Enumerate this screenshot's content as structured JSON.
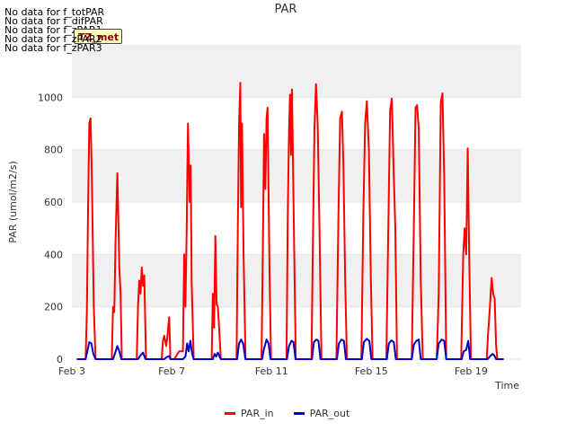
{
  "no_data_messages": [
    "No data for f_totPAR",
    "No data for f_difPAR",
    "No data for f_zPAR1",
    "No data for f_zPAR2",
    "No data for f_zPAR3"
  ],
  "badge_text": "TZ_met",
  "colors": {
    "PAR_in": "#ff0000",
    "PAR_out": "#0000cc",
    "band": "#f0f0f0",
    "grid": "#ffffff"
  },
  "chart_data": {
    "type": "line",
    "title": "PAR",
    "xlabel": "Time",
    "ylabel": "PAR (umol/m2/s)",
    "xlim": [
      3.0,
      21.0
    ],
    "ylim": [
      0,
      1200
    ],
    "yticks": [
      0,
      200,
      400,
      600,
      800,
      1000
    ],
    "xticks": [
      3,
      7,
      11,
      15,
      19
    ],
    "xtick_labels": [
      "Feb 3",
      "Feb 7",
      "Feb 11",
      "Feb 15",
      "Feb 19"
    ],
    "legend": "bottom-center",
    "grid": true,
    "series": [
      {
        "name": "PAR_in",
        "points": [
          [
            3.2,
            0
          ],
          [
            3.55,
            0
          ],
          [
            3.6,
            180
          ],
          [
            3.65,
            600
          ],
          [
            3.7,
            900
          ],
          [
            3.75,
            920
          ],
          [
            3.8,
            700
          ],
          [
            3.88,
            200
          ],
          [
            3.95,
            0
          ],
          [
            4.6,
            0
          ],
          [
            4.65,
            200
          ],
          [
            4.7,
            180
          ],
          [
            4.75,
            450
          ],
          [
            4.82,
            710
          ],
          [
            4.86,
            540
          ],
          [
            4.9,
            350
          ],
          [
            4.95,
            250
          ],
          [
            5.0,
            0
          ],
          [
            5.6,
            0
          ],
          [
            5.65,
            200
          ],
          [
            5.7,
            300
          ],
          [
            5.75,
            250
          ],
          [
            5.8,
            350
          ],
          [
            5.85,
            280
          ],
          [
            5.9,
            320
          ],
          [
            5.97,
            0
          ],
          [
            6.6,
            0
          ],
          [
            6.65,
            70
          ],
          [
            6.7,
            90
          ],
          [
            6.78,
            50
          ],
          [
            6.82,
            80
          ],
          [
            6.9,
            160
          ],
          [
            6.95,
            0
          ],
          [
            7.1,
            0
          ],
          [
            7.3,
            30
          ],
          [
            7.45,
            30
          ],
          [
            7.5,
            400
          ],
          [
            7.55,
            200
          ],
          [
            7.6,
            500
          ],
          [
            7.65,
            900
          ],
          [
            7.72,
            600
          ],
          [
            7.76,
            740
          ],
          [
            7.8,
            300
          ],
          [
            7.88,
            0
          ],
          [
            8.6,
            0
          ],
          [
            8.65,
            250
          ],
          [
            8.7,
            120
          ],
          [
            8.75,
            470
          ],
          [
            8.8,
            210
          ],
          [
            8.85,
            200
          ],
          [
            8.9,
            120
          ],
          [
            8.97,
            0
          ],
          [
            9.6,
            0
          ],
          [
            9.65,
            500
          ],
          [
            9.7,
            900
          ],
          [
            9.75,
            1055
          ],
          [
            9.78,
            580
          ],
          [
            9.82,
            900
          ],
          [
            9.88,
            400
          ],
          [
            9.96,
            0
          ],
          [
            10.6,
            0
          ],
          [
            10.65,
            400
          ],
          [
            10.7,
            860
          ],
          [
            10.75,
            650
          ],
          [
            10.8,
            920
          ],
          [
            10.84,
            960
          ],
          [
            10.88,
            650
          ],
          [
            10.92,
            330
          ],
          [
            10.98,
            0
          ],
          [
            11.6,
            0
          ],
          [
            11.65,
            550
          ],
          [
            11.7,
            870
          ],
          [
            11.74,
            1010
          ],
          [
            11.78,
            780
          ],
          [
            11.82,
            1030
          ],
          [
            11.88,
            600
          ],
          [
            11.97,
            0
          ],
          [
            12.6,
            0
          ],
          [
            12.65,
            400
          ],
          [
            12.72,
            880
          ],
          [
            12.78,
            1050
          ],
          [
            12.85,
            900
          ],
          [
            12.92,
            500
          ],
          [
            13.0,
            0
          ],
          [
            13.6,
            0
          ],
          [
            13.68,
            550
          ],
          [
            13.75,
            920
          ],
          [
            13.82,
            945
          ],
          [
            13.88,
            750
          ],
          [
            13.95,
            300
          ],
          [
            14.02,
            0
          ],
          [
            14.6,
            0
          ],
          [
            14.68,
            550
          ],
          [
            14.75,
            900
          ],
          [
            14.82,
            985
          ],
          [
            14.9,
            800
          ],
          [
            14.98,
            300
          ],
          [
            15.05,
            0
          ],
          [
            15.6,
            0
          ],
          [
            15.68,
            500
          ],
          [
            15.75,
            950
          ],
          [
            15.82,
            995
          ],
          [
            15.9,
            700
          ],
          [
            15.96,
            500
          ],
          [
            16.03,
            0
          ],
          [
            16.62,
            0
          ],
          [
            16.7,
            500
          ],
          [
            16.77,
            960
          ],
          [
            16.83,
            970
          ],
          [
            16.9,
            880
          ],
          [
            16.98,
            300
          ],
          [
            17.06,
            0
          ],
          [
            17.62,
            0
          ],
          [
            17.7,
            250
          ],
          [
            17.78,
            980
          ],
          [
            17.85,
            1015
          ],
          [
            17.92,
            700
          ],
          [
            18.0,
            0
          ],
          [
            18.6,
            0
          ],
          [
            18.68,
            400
          ],
          [
            18.74,
            500
          ],
          [
            18.8,
            400
          ],
          [
            18.86,
            805
          ],
          [
            18.92,
            400
          ],
          [
            18.99,
            0
          ],
          [
            19.62,
            0
          ],
          [
            19.68,
            100
          ],
          [
            19.75,
            200
          ],
          [
            19.82,
            310
          ],
          [
            19.88,
            250
          ],
          [
            19.94,
            230
          ],
          [
            20.0,
            50
          ],
          [
            20.05,
            0
          ],
          [
            20.3,
            0
          ]
        ]
      },
      {
        "name": "PAR_out",
        "points": [
          [
            3.2,
            0
          ],
          [
            3.55,
            0
          ],
          [
            3.62,
            30
          ],
          [
            3.7,
            65
          ],
          [
            3.78,
            60
          ],
          [
            3.86,
            20
          ],
          [
            3.95,
            0
          ],
          [
            4.65,
            0
          ],
          [
            4.72,
            20
          ],
          [
            4.82,
            50
          ],
          [
            4.9,
            30
          ],
          [
            4.98,
            0
          ],
          [
            5.65,
            0
          ],
          [
            5.75,
            15
          ],
          [
            5.85,
            25
          ],
          [
            5.95,
            0
          ],
          [
            6.7,
            0
          ],
          [
            6.8,
            8
          ],
          [
            6.9,
            12
          ],
          [
            6.95,
            0
          ],
          [
            7.45,
            0
          ],
          [
            7.55,
            10
          ],
          [
            7.62,
            60
          ],
          [
            7.68,
            30
          ],
          [
            7.75,
            70
          ],
          [
            7.82,
            20
          ],
          [
            7.88,
            0
          ],
          [
            8.65,
            0
          ],
          [
            8.72,
            20
          ],
          [
            8.78,
            10
          ],
          [
            8.85,
            25
          ],
          [
            8.92,
            10
          ],
          [
            8.97,
            0
          ],
          [
            9.62,
            0
          ],
          [
            9.7,
            60
          ],
          [
            9.78,
            75
          ],
          [
            9.86,
            60
          ],
          [
            9.95,
            0
          ],
          [
            10.62,
            0
          ],
          [
            10.7,
            40
          ],
          [
            10.8,
            75
          ],
          [
            10.88,
            60
          ],
          [
            10.96,
            0
          ],
          [
            11.62,
            0
          ],
          [
            11.7,
            50
          ],
          [
            11.8,
            70
          ],
          [
            11.88,
            65
          ],
          [
            11.96,
            0
          ],
          [
            12.62,
            0
          ],
          [
            12.7,
            65
          ],
          [
            12.8,
            75
          ],
          [
            12.88,
            70
          ],
          [
            12.96,
            0
          ],
          [
            13.62,
            0
          ],
          [
            13.7,
            60
          ],
          [
            13.8,
            75
          ],
          [
            13.9,
            70
          ],
          [
            13.98,
            0
          ],
          [
            14.62,
            0
          ],
          [
            14.7,
            65
          ],
          [
            14.82,
            78
          ],
          [
            14.92,
            70
          ],
          [
            15.0,
            0
          ],
          [
            15.62,
            0
          ],
          [
            15.7,
            60
          ],
          [
            15.8,
            72
          ],
          [
            15.9,
            65
          ],
          [
            15.98,
            0
          ],
          [
            16.62,
            0
          ],
          [
            16.7,
            55
          ],
          [
            16.8,
            70
          ],
          [
            16.9,
            75
          ],
          [
            16.98,
            0
          ],
          [
            17.62,
            0
          ],
          [
            17.7,
            60
          ],
          [
            17.82,
            75
          ],
          [
            17.92,
            70
          ],
          [
            18.0,
            0
          ],
          [
            18.62,
            0
          ],
          [
            18.7,
            30
          ],
          [
            18.8,
            35
          ],
          [
            18.88,
            70
          ],
          [
            18.96,
            0
          ],
          [
            19.65,
            0
          ],
          [
            19.75,
            10
          ],
          [
            19.85,
            20
          ],
          [
            19.92,
            15
          ],
          [
            20.0,
            0
          ],
          [
            20.3,
            0
          ]
        ]
      }
    ]
  }
}
